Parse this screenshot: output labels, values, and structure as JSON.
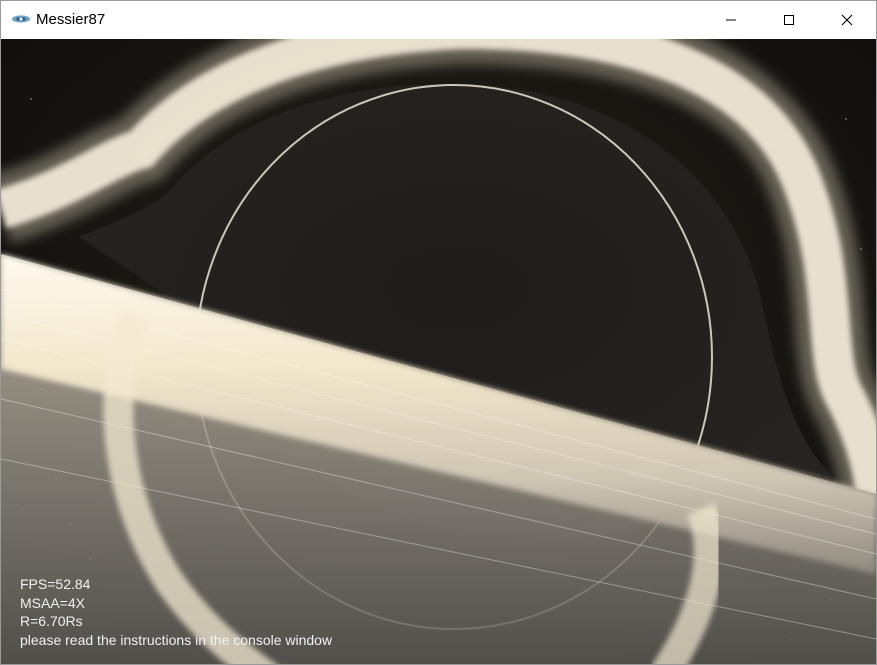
{
  "window": {
    "title": "Messier87",
    "app_icon": "galaxy-icon",
    "controls": [
      "minimize-icon",
      "maximize-icon",
      "close-icon"
    ]
  },
  "viewport": {
    "scene": "black-hole-render",
    "hud": {
      "fps": "FPS=52.84",
      "msaa": "MSAA=4X",
      "radius": "R=6.70Rs",
      "instructions": "please read the instructions in the console window"
    }
  },
  "colors": {
    "disk": "#f4ead2",
    "disk_warm": "#d9c9a2",
    "shadow": "#1c1b17",
    "space": "#141310",
    "hud_text": "#f2f2f2"
  }
}
